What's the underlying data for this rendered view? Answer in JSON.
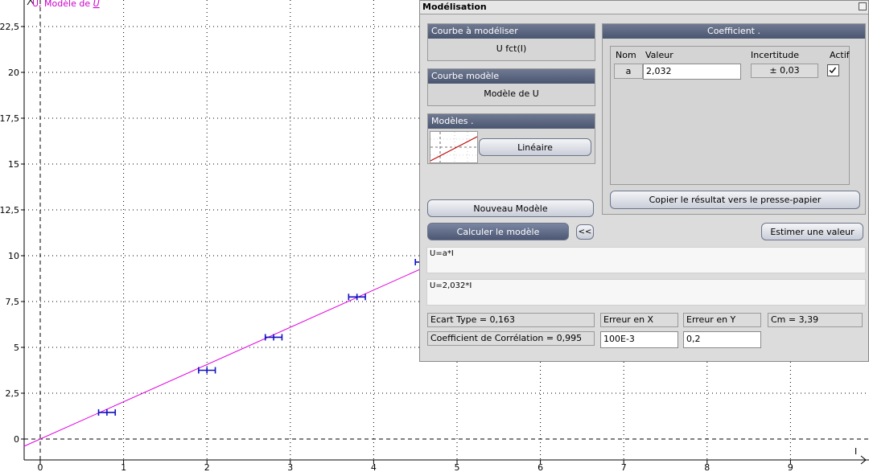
{
  "graph": {
    "y_axis_label": "U, Modèle de",
    "y_axis_label_var": "U",
    "x_axis_label": "I",
    "x_ticks": [
      "0",
      "1",
      "2",
      "3",
      "4",
      "5",
      "6",
      "7",
      "8",
      "9"
    ],
    "y_ticks": [
      "0",
      "2,5",
      "5",
      "7,5",
      "10",
      "12,5",
      "15",
      "17,5",
      "20",
      "22,5"
    ],
    "model_color": "#e000e0",
    "point_color": "#1010c0",
    "label_color": "#cc00cc"
  },
  "chart_data": {
    "type": "scatter",
    "x": [
      0.8,
      2.0,
      2.8,
      3.8,
      4.6
    ],
    "y": [
      1.45,
      3.75,
      5.55,
      7.75,
      9.65
    ],
    "x_error": 0.1,
    "model": {
      "slope": 2.032
    },
    "xlim": [
      -0.3,
      10.2
    ],
    "ylim": [
      -1.8,
      24.5
    ],
    "grid": true
  },
  "window": {
    "title": "Modélisation",
    "curve_to_model": {
      "header": "Courbe à modéliser",
      "value": "U   fct(I)"
    },
    "model_curve": {
      "header": "Courbe modèle",
      "value": "Modèle de U"
    },
    "models": {
      "header": "Modèles .",
      "button": "Linéaire"
    },
    "coefficient": {
      "header": "Coefficient .",
      "col_name": "Nom",
      "col_value": "Valeur",
      "col_uncertainty": "Incertitude",
      "col_active": "Actif",
      "rows": [
        {
          "name": "a",
          "value": "2,032",
          "uncertainty": "± 0,03",
          "active": true
        }
      ]
    },
    "copy_button": "Copier le résultat vers le presse-papier",
    "new_model_button": "Nouveau Modèle",
    "compute_button": "Calculer le modèle",
    "collapse_button": "<<",
    "estimate_button": "Estimer une valeur",
    "equation": "U=a*I",
    "result": "U=2,032*I",
    "stats": {
      "std_dev": "Ecart Type = 0,163",
      "error_x_label": "Erreur en X",
      "error_y_label": "Erreur en Y",
      "cm": "Cm = 3,39",
      "correlation": "Coefficient de Corrélation = 0,995",
      "error_x_value": "100E-3",
      "error_y_value": "0,2"
    }
  }
}
